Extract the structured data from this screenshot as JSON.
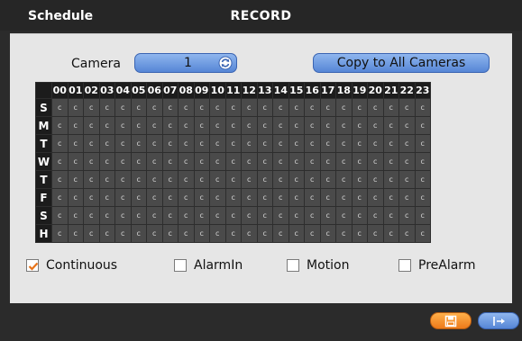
{
  "header": {
    "left_title": "Schedule",
    "center_title": "RECORD"
  },
  "camera": {
    "label": "Camera",
    "value": "1"
  },
  "copy_button": {
    "label": "Copy to All Cameras"
  },
  "hours": [
    "00",
    "01",
    "02",
    "03",
    "04",
    "05",
    "06",
    "07",
    "08",
    "09",
    "10",
    "11",
    "12",
    "13",
    "14",
    "15",
    "16",
    "17",
    "18",
    "19",
    "20",
    "21",
    "22",
    "23"
  ],
  "days": [
    "S",
    "M",
    "T",
    "W",
    "T",
    "F",
    "S",
    "H"
  ],
  "cell_value": "c",
  "options": [
    {
      "label": "Continuous",
      "checked": true
    },
    {
      "label": "AlarmIn",
      "checked": false
    },
    {
      "label": "Motion",
      "checked": false
    },
    {
      "label": "PreAlarm",
      "checked": false
    }
  ],
  "colors": {
    "button_blue": "#6d99e0",
    "button_orange": "#f39a30",
    "check_orange": "#e8741a",
    "cell_bg": "#4a4a4a",
    "panel_bg": "#e6e6e6"
  }
}
